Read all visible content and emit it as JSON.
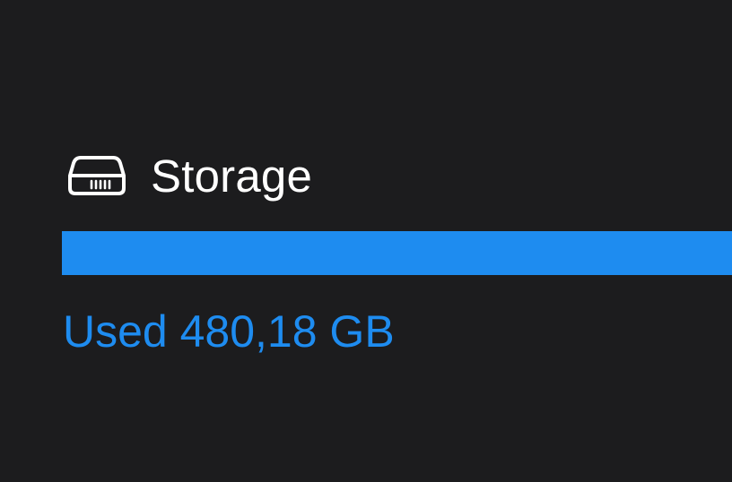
{
  "storage": {
    "icon": "hard-drive-icon",
    "title": "Storage",
    "usage_fraction": 1.0,
    "used_label": "Used 480,18 GB",
    "accent_color": "#1e8cf0",
    "background_color": "#1c1c1e",
    "title_color": "#ffffff"
  }
}
